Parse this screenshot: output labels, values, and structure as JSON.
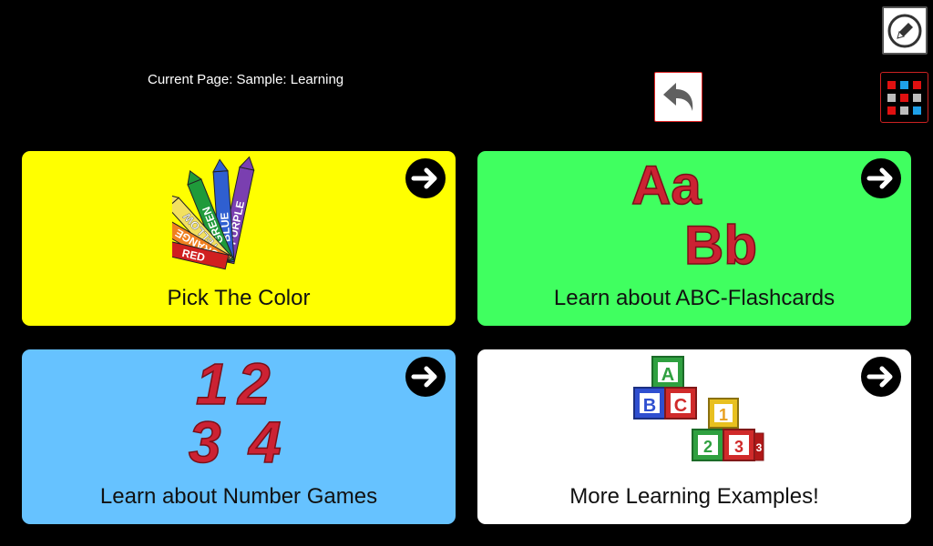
{
  "header": {
    "current_page": "Current Page: Sample: Learning"
  },
  "toolbar": {
    "edit_icon": "pencil-icon",
    "back_icon": "undo-arrow-icon",
    "grid_icon": "grid-menu-icon"
  },
  "colors": {
    "background": "#000000",
    "tile_yellow": "#ffff00",
    "tile_green": "#40ff60",
    "tile_blue": "#66c2ff",
    "tile_white": "#ffffff"
  },
  "tiles": [
    {
      "label": "Pick The Color",
      "color": "#ffff00",
      "icon": "crayons-icon",
      "crayons": [
        "RED",
        "ORANGE",
        "YELLOW",
        "GREEN",
        "BLUE",
        "PURPLE"
      ]
    },
    {
      "label": "Learn about ABC-Flashcards",
      "color": "#40ff60",
      "icon": "letters-icon",
      "letters": [
        "Aa",
        "Bb"
      ]
    },
    {
      "label": "Learn about Number Games",
      "color": "#66c2ff",
      "icon": "numbers-icon",
      "numbers": [
        "1",
        "2",
        "3",
        "4"
      ]
    },
    {
      "label": "More Learning Examples!",
      "color": "#ffffff",
      "icon": "blocks-icon",
      "blocks": [
        "A",
        "B",
        "C",
        "1",
        "2",
        "3",
        "3"
      ]
    }
  ]
}
